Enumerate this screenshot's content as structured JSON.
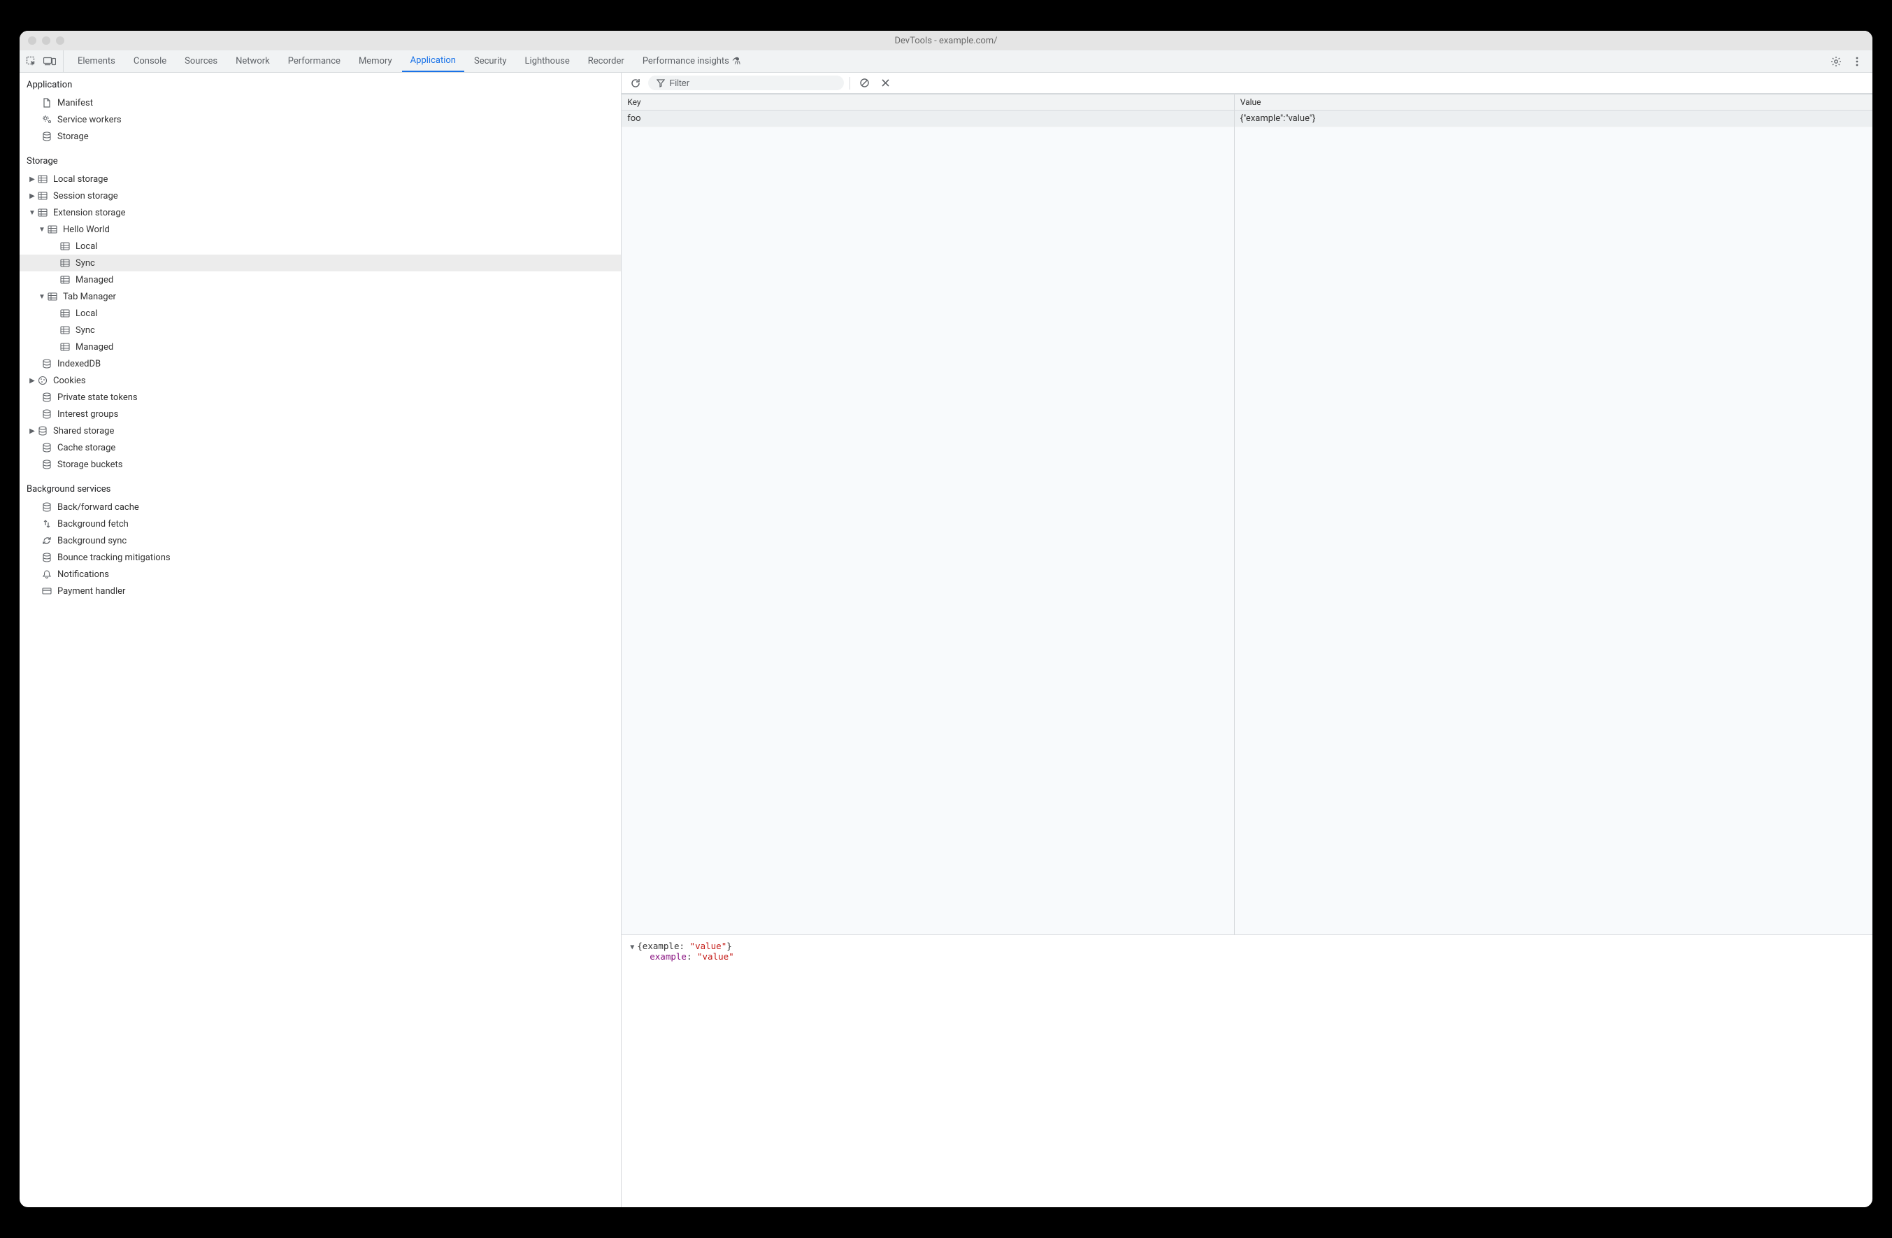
{
  "window_title": "DevTools - example.com/",
  "tabs": {
    "elements": "Elements",
    "console": "Console",
    "sources": "Sources",
    "network": "Network",
    "performance": "Performance",
    "memory": "Memory",
    "application": "Application",
    "security": "Security",
    "lighthouse": "Lighthouse",
    "recorder": "Recorder",
    "perf_insights": "Performance insights"
  },
  "filter_placeholder": "Filter",
  "sidebar": {
    "groups": {
      "application": {
        "label": "Application",
        "items": {
          "manifest": "Manifest",
          "service_workers": "Service workers",
          "storage": "Storage"
        }
      },
      "storage": {
        "label": "Storage",
        "items": {
          "local_storage": "Local storage",
          "session_storage": "Session storage",
          "extension_storage": "Extension storage",
          "hello_world": "Hello World",
          "hw_local": "Local",
          "hw_sync": "Sync",
          "hw_managed": "Managed",
          "tab_manager": "Tab Manager",
          "tm_local": "Local",
          "tm_sync": "Sync",
          "tm_managed": "Managed",
          "indexeddb": "IndexedDB",
          "cookies": "Cookies",
          "private_state_tokens": "Private state tokens",
          "interest_groups": "Interest groups",
          "shared_storage": "Shared storage",
          "cache_storage": "Cache storage",
          "storage_buckets": "Storage buckets"
        }
      },
      "background": {
        "label": "Background services",
        "items": {
          "bfcache": "Back/forward cache",
          "bg_fetch": "Background fetch",
          "bg_sync": "Background sync",
          "bounce": "Bounce tracking mitigations",
          "notifications": "Notifications",
          "payment": "Payment handler"
        }
      }
    }
  },
  "table": {
    "headers": {
      "key": "Key",
      "value": "Value"
    },
    "rows": [
      {
        "key": "foo",
        "value": "{\"example\":\"value\"}"
      }
    ]
  },
  "detail": {
    "summary_pre": "{example: ",
    "summary_val": "\"value\"",
    "summary_post": "}",
    "ex_key": "example",
    "ex_sep": ": ",
    "ex_val": "\"value\""
  }
}
